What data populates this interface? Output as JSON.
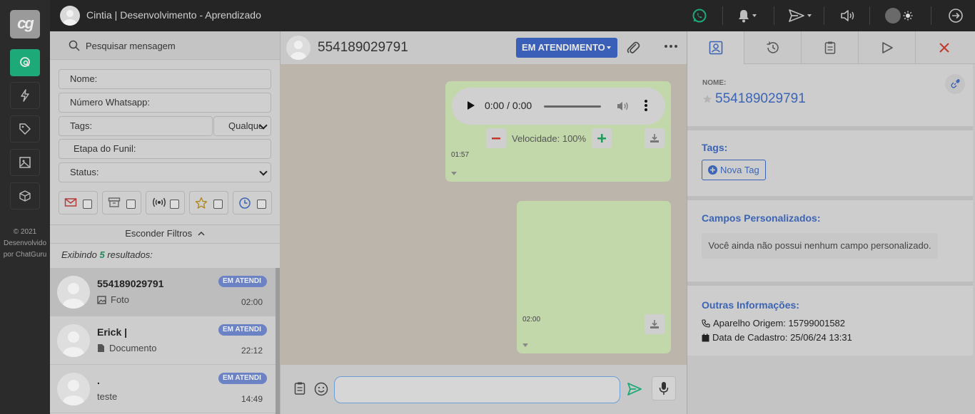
{
  "app": {
    "logo_text": "cg",
    "footer_lines": [
      "© 2021",
      "Desenvolvido",
      "por ChatGuru"
    ]
  },
  "rail": {
    "items": [
      {
        "icon": "chat-search-icon",
        "active": true
      },
      {
        "icon": "lightning-icon",
        "active": false
      },
      {
        "icon": "tag-icon",
        "active": false
      },
      {
        "icon": "image-icon",
        "active": false
      },
      {
        "icon": "box-icon",
        "active": false
      }
    ]
  },
  "topbar": {
    "title": "Cintia | Desenvolvimento - Aprendizado",
    "icons": [
      "whatsapp-icon",
      "bell-icon",
      "send-icon",
      "volume-icon",
      "theme-toggle",
      "logout-icon"
    ]
  },
  "sidebar": {
    "search_placeholder": "Pesquisar mensagem",
    "filters": {
      "nome": "Nome:",
      "numero": "Número Whatsapp:",
      "tags": "Tags:",
      "tags_mode": "Qualque",
      "etapa": "Etapa do Funil:",
      "status": "Status:"
    },
    "chips": [
      "mail-icon",
      "archive-icon",
      "broadcast-icon",
      "star-icon",
      "clock-icon"
    ],
    "hide_filters_label": "Esconder Filtros",
    "results_prefix": "Exibindo ",
    "results_count": "5",
    "results_suffix": " resultados:",
    "chats": [
      {
        "name": "554189029791",
        "badge": "EM ATENDI",
        "sub_icon": "image-icon",
        "sub": "Foto",
        "time": "02:00",
        "selected": true
      },
      {
        "name": "Erick |",
        "badge": "EM ATENDI",
        "sub_icon": "document-icon",
        "sub": "Documento",
        "time": "22:12",
        "selected": false
      },
      {
        "name": ".",
        "badge": "EM ATENDI",
        "sub_icon": "",
        "sub": "teste",
        "time": "14:49",
        "selected": false
      }
    ]
  },
  "chat": {
    "title": "554189029791",
    "status_button": "EM ATENDIMENTO",
    "audio_time": "0:00 / 0:00",
    "speed_label": "Velocidade: 100%",
    "msg1_time": "01:57",
    "msg2_time": "02:00",
    "composer_placeholder": ""
  },
  "right": {
    "tabs": [
      "contact-card-icon",
      "history-icon",
      "clipboard-icon",
      "play-icon",
      "close-icon"
    ],
    "nome_label": "NOME:",
    "nome_value": "554189029791",
    "tags_title": "Tags:",
    "new_tag": "Nova Tag",
    "custom_title": "Campos Personalizados:",
    "custom_empty": "Você ainda não possui nenhum campo personalizado.",
    "other_title": "Outras Informações:",
    "device_label": "Aparelho Origem: 15799001582",
    "created_label": "Data de Cadastro: 25/06/24 13:31"
  },
  "colors": {
    "accent_green": "#1eaa78",
    "status_blue": "#3a5fb8",
    "link_blue": "#3c64b4",
    "badge_blue": "#6b82c4",
    "bubble_green": "#c2d7aa"
  }
}
